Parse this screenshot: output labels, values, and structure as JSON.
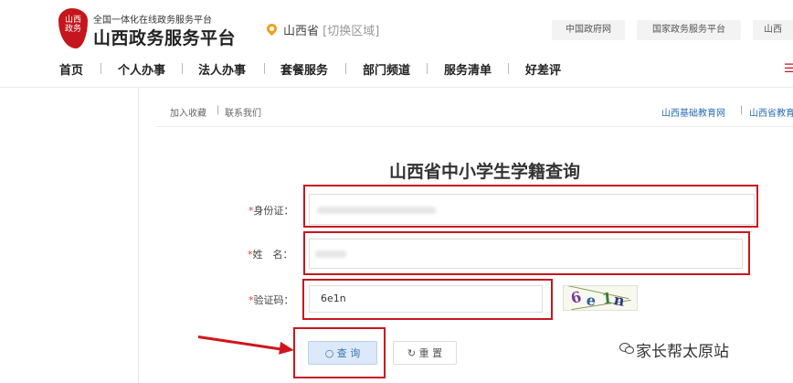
{
  "header": {
    "logo_seal_text": "山西政务",
    "logo_subtitle": "全国一体化在线政务服务平台",
    "logo_title": "山西政务服务平台",
    "location": "山西省",
    "location_switch": "[切换区域]",
    "top_links": [
      "中国政府网",
      "国家政务服务平台",
      "山西"
    ]
  },
  "nav": {
    "items": [
      "首页",
      "个人办事",
      "法人办事",
      "套餐服务",
      "部门频道",
      "服务清单",
      "好差评"
    ]
  },
  "utility": {
    "left": [
      "加入收藏",
      "联系我们"
    ],
    "right": [
      "山西基础教育网",
      "山西省教育"
    ]
  },
  "form": {
    "title": "山西省中小学生学籍查询",
    "id_label": "身份证",
    "name_label": "姓　名",
    "captcha_label": "验证码",
    "captcha_value": "6e1n",
    "captcha_image_text": "6e1n",
    "query_button": "查 询",
    "reset_button": "重 置"
  },
  "watermark": {
    "text": "家长帮太原站"
  },
  "colors": {
    "brand_red": "#c4161c",
    "annotation_red": "#c8161d",
    "link_blue": "#2a6db5",
    "query_button_bg": "#dbe9f8"
  },
  "icons": {
    "location": "map-pin-icon",
    "query": "search-icon",
    "reset": "refresh-icon",
    "watermark": "wechat-icon",
    "nav_extra": "list-icon"
  }
}
